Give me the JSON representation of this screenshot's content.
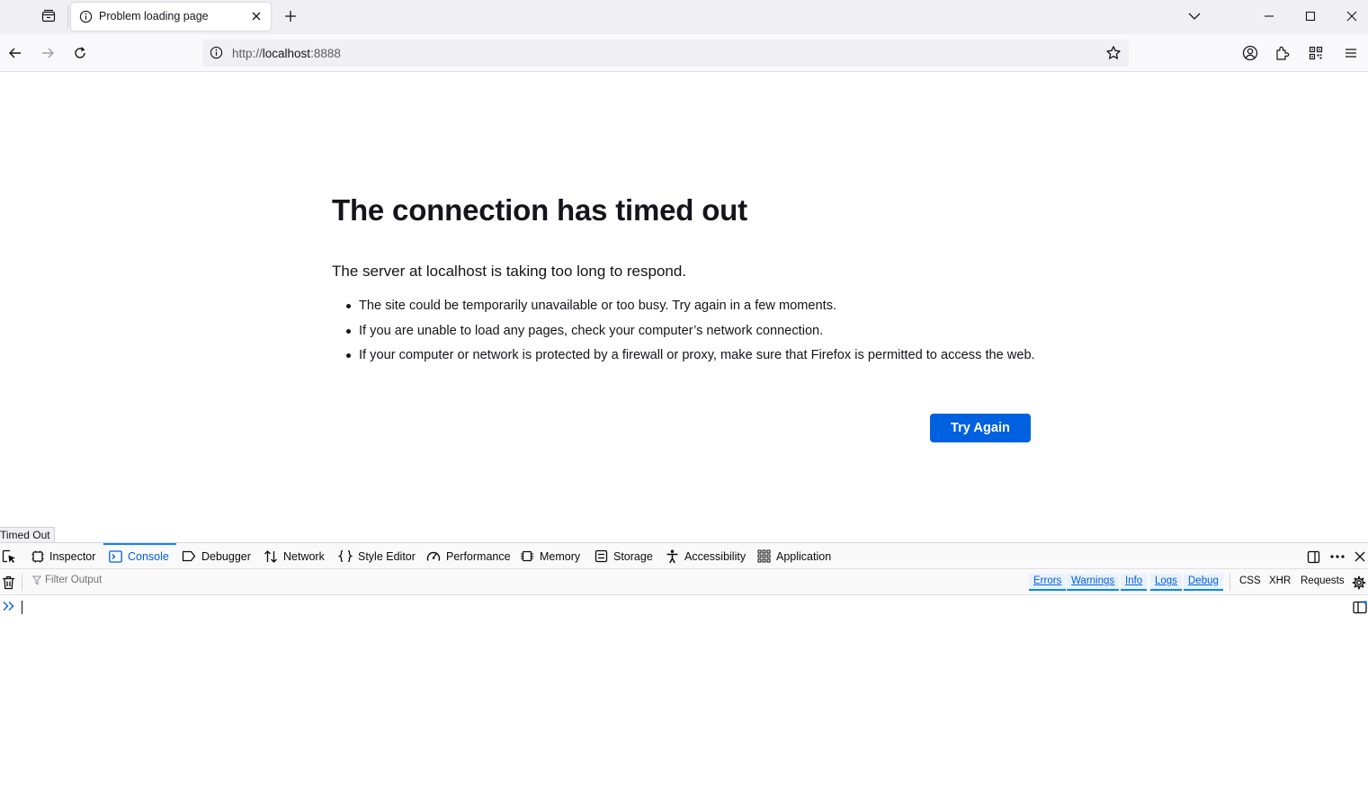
{
  "browser": {
    "tab": {
      "title": "Problem loading page"
    },
    "url": {
      "scheme": "http://",
      "host": "localhost",
      "port": ":8888"
    }
  },
  "error_page": {
    "title": "The connection has timed out",
    "description": "The server at localhost is taking too long to respond.",
    "suggestions": [
      "The site could be temporarily unavailable or too busy. Try again in a few moments.",
      "If you are unable to load any pages, check your computer’s network connection.",
      "If your computer or network is protected by a firewall or proxy, make sure that Firefox is permitted to access the web."
    ],
    "try_again_label": "Try Again"
  },
  "status_tooltip": "Timed Out",
  "devtools": {
    "tabs": [
      {
        "label": "Inspector",
        "icon": "inspector-icon"
      },
      {
        "label": "Console",
        "icon": "console-icon",
        "active": true
      },
      {
        "label": "Debugger",
        "icon": "debugger-icon"
      },
      {
        "label": "Network",
        "icon": "network-icon"
      },
      {
        "label": "Style Editor",
        "icon": "style-editor-icon"
      },
      {
        "label": "Performance",
        "icon": "performance-icon"
      },
      {
        "label": "Memory",
        "icon": "memory-icon"
      },
      {
        "label": "Storage",
        "icon": "storage-icon"
      },
      {
        "label": "Accessibility",
        "icon": "accessibility-icon"
      },
      {
        "label": "Application",
        "icon": "application-icon"
      }
    ],
    "console_toolbar": {
      "filter_placeholder": "Filter Output",
      "levels": [
        "Errors",
        "Warnings",
        "Info",
        "Logs",
        "Debug"
      ],
      "requests": [
        "CSS",
        "XHR",
        "Requests"
      ]
    }
  },
  "colors": {
    "accent": "#0061e0",
    "devtools_active": "#0a84ff"
  }
}
